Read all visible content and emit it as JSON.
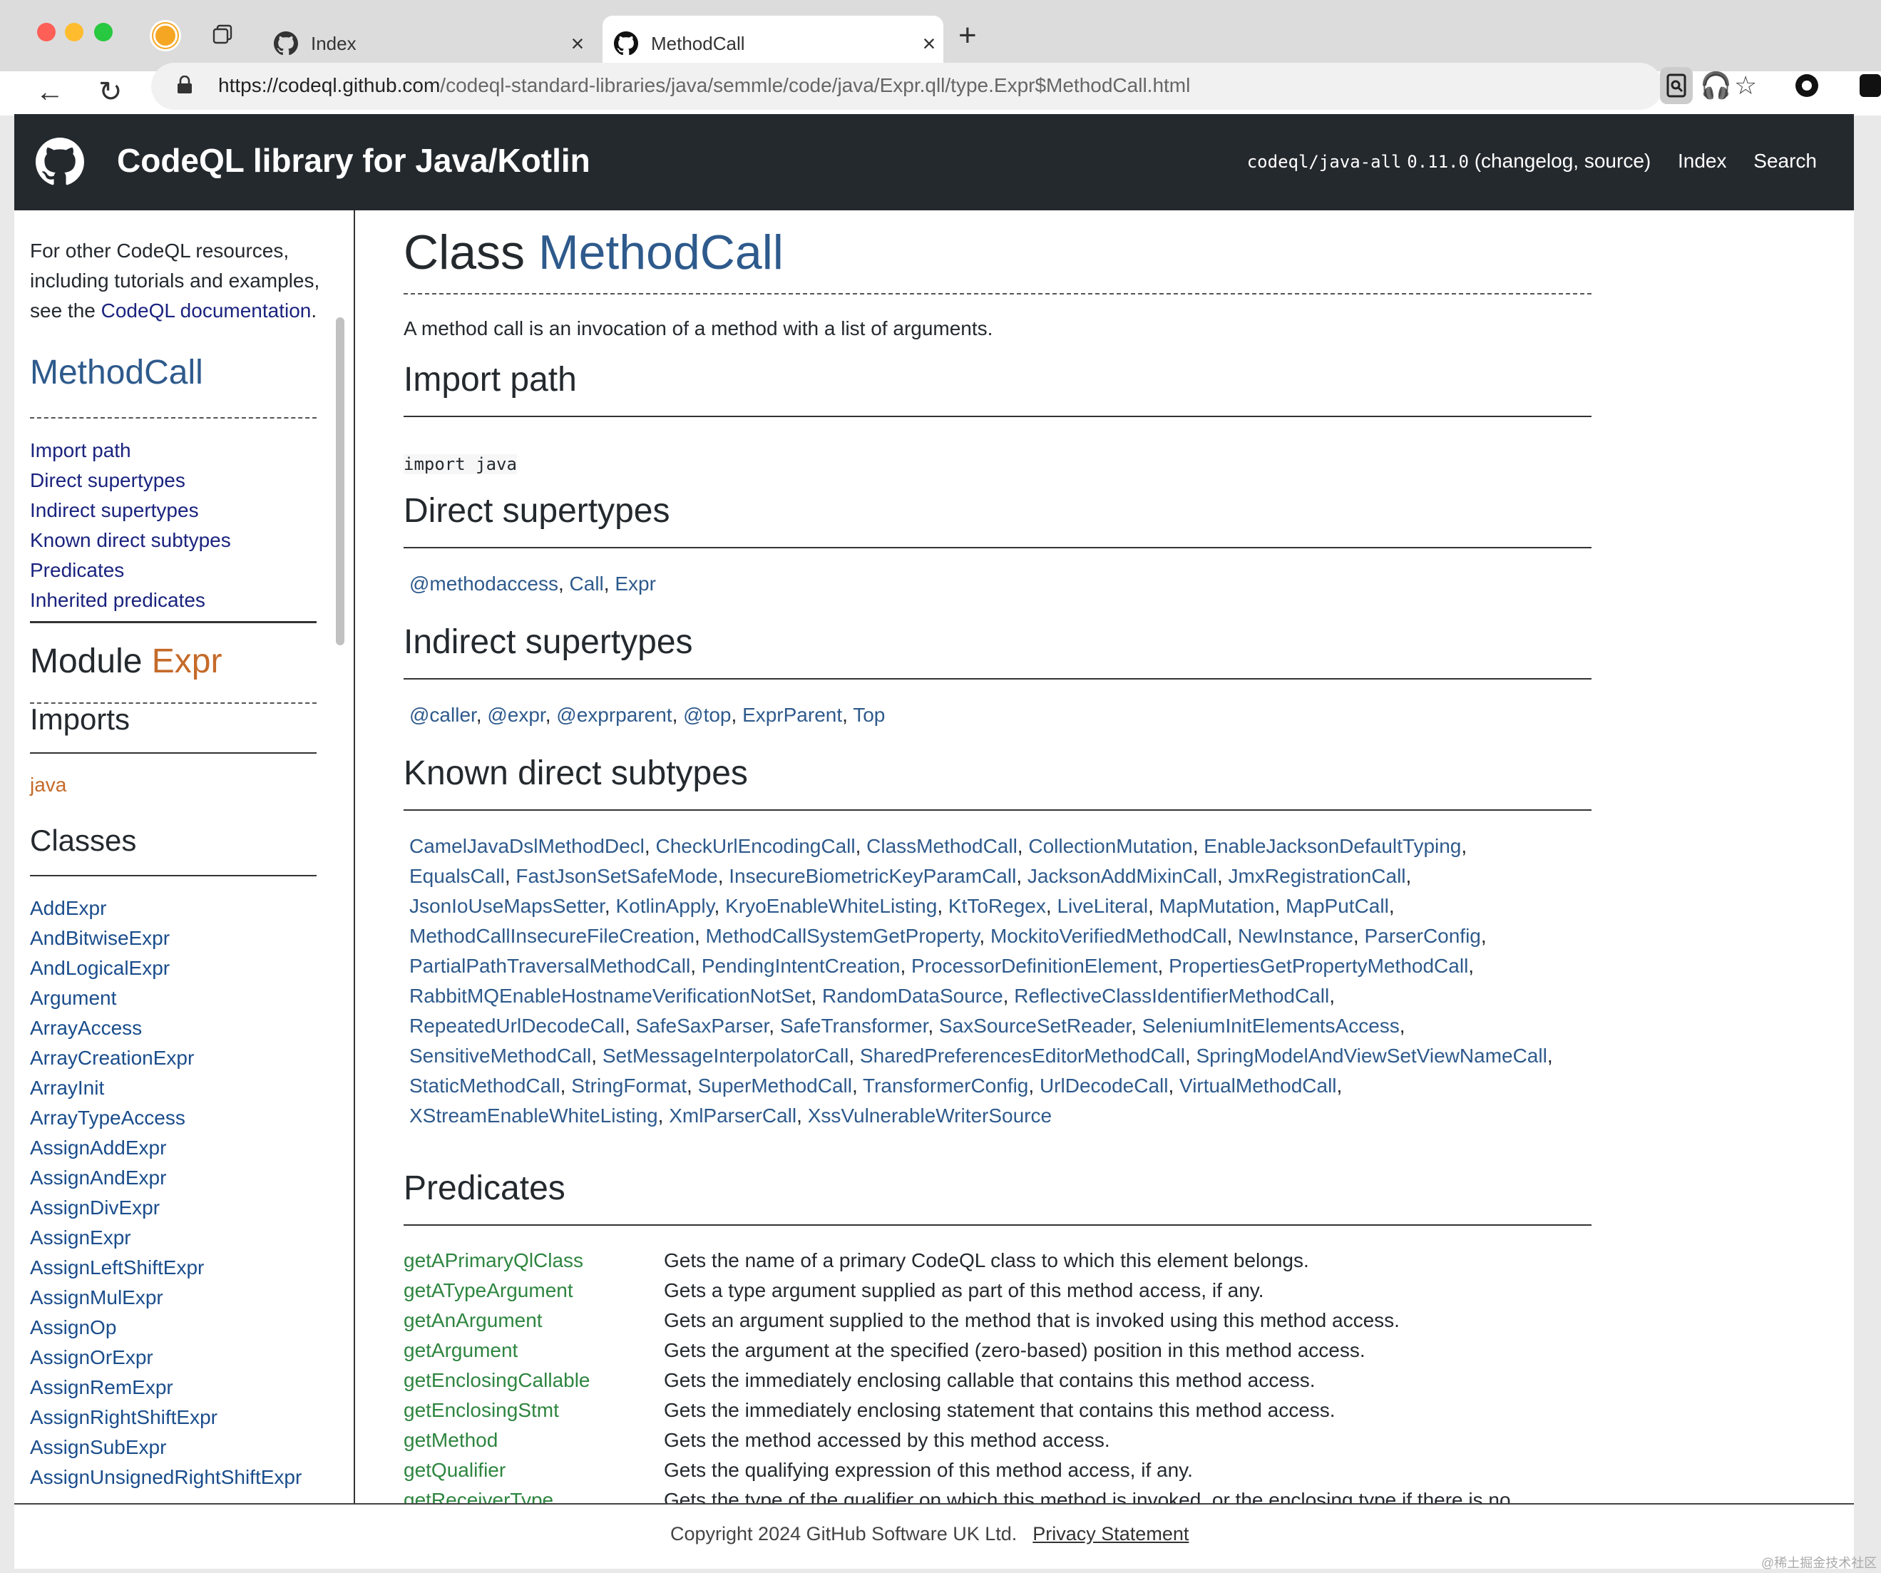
{
  "browser": {
    "tabs": [
      {
        "title": "Index"
      },
      {
        "title": "MethodCall"
      }
    ],
    "url_domain": "https://codeql.github.com",
    "url_path": "/codeql-standard-libraries/java/semmle/code/java/Expr.qll/type.Expr$MethodCall.html"
  },
  "header": {
    "title": "CodeQL library for Java/Kotlin",
    "package": "codeql/java-all",
    "version": "0.11.0",
    "version_links": "(changelog, source)",
    "index_link": "Index",
    "search_link": "Search"
  },
  "sidebar": {
    "intro_prefix": "For other CodeQL resources, including tutorials and examples, see the ",
    "intro_link": "CodeQL documentation",
    "intro_suffix": ".",
    "class_name": "MethodCall",
    "toc": [
      "Import path",
      "Direct supertypes",
      "Indirect supertypes",
      "Known direct subtypes",
      "Predicates",
      "Inherited predicates"
    ],
    "module_label": "Module",
    "module_name": "Expr",
    "imports_heading": "Imports",
    "imports": [
      "java"
    ],
    "classes_heading": "Classes",
    "classes": [
      "AddExpr",
      "AndBitwiseExpr",
      "AndLogicalExpr",
      "Argument",
      "ArrayAccess",
      "ArrayCreationExpr",
      "ArrayInit",
      "ArrayTypeAccess",
      "AssignAddExpr",
      "AssignAndExpr",
      "AssignDivExpr",
      "AssignExpr",
      "AssignLeftShiftExpr",
      "AssignMulExpr",
      "AssignOp",
      "AssignOrExpr",
      "AssignRemExpr",
      "AssignRightShiftExpr",
      "AssignSubExpr",
      "AssignUnsignedRightShiftExpr"
    ]
  },
  "main": {
    "class_label": "Class",
    "class_name": "MethodCall",
    "description": "A method call is an invocation of a method with a list of arguments.",
    "import_path_heading": "Import path",
    "import_code": "import java",
    "direct_supertypes_heading": "Direct supertypes",
    "direct_supertypes": [
      "@methodaccess",
      "Call",
      "Expr"
    ],
    "indirect_supertypes_heading": "Indirect supertypes",
    "indirect_supertypes": [
      "@caller",
      "@expr",
      "@exprparent",
      "@top",
      "ExprParent",
      "Top"
    ],
    "known_subtypes_heading": "Known direct subtypes",
    "known_subtypes_lines": [
      [
        "CamelJavaDslMethodDecl",
        "CheckUrlEncodingCall",
        "ClassMethodCall",
        "CollectionMutation",
        "EnableJacksonDefaultTyping"
      ],
      [
        "EqualsCall",
        "FastJsonSetSafeMode",
        "InsecureBiometricKeyParamCall",
        "JacksonAddMixinCall",
        "JmxRegistrationCall"
      ],
      [
        "JsonIoUseMapsSetter",
        "KotlinApply",
        "KryoEnableWhiteListing",
        "KtToRegex",
        "LiveLiteral",
        "MapMutation",
        "MapPutCall"
      ],
      [
        "MethodCallInsecureFileCreation",
        "MethodCallSystemGetProperty",
        "MockitoVerifiedMethodCall",
        "NewInstance",
        "ParserConfig"
      ],
      [
        "PartialPathTraversalMethodCall",
        "PendingIntentCreation",
        "ProcessorDefinitionElement",
        "PropertiesGetPropertyMethodCall"
      ],
      [
        "RabbitMQEnableHostnameVerificationNotSet",
        "RandomDataSource",
        "ReflectiveClassIdentifierMethodCall"
      ],
      [
        "RepeatedUrlDecodeCall",
        "SafeSaxParser",
        "SafeTransformer",
        "SaxSourceSetReader",
        "SeleniumInitElementsAccess"
      ],
      [
        "SensitiveMethodCall",
        "SetMessageInterpolatorCall",
        "SharedPreferencesEditorMethodCall",
        "SpringModelAndViewSetViewNameCall"
      ],
      [
        "StaticMethodCall",
        "StringFormat",
        "SuperMethodCall",
        "TransformerConfig",
        "UrlDecodeCall",
        "VirtualMethodCall"
      ],
      [
        "XStreamEnableWhiteListing",
        "XmlParserCall",
        "XssVulnerableWriterSource"
      ]
    ],
    "predicates_heading": "Predicates",
    "predicates": [
      {
        "name": "getAPrimaryQlClass",
        "desc": "Gets the name of a primary CodeQL class to which this element belongs."
      },
      {
        "name": "getATypeArgument",
        "desc": "Gets a type argument supplied as part of this method access, if any."
      },
      {
        "name": "getAnArgument",
        "desc": "Gets an argument supplied to the method that is invoked using this method access."
      },
      {
        "name": "getArgument",
        "desc": "Gets the argument at the specified (zero-based) position in this method access."
      },
      {
        "name": "getEnclosingCallable",
        "desc": "Gets the immediately enclosing callable that contains this method access."
      },
      {
        "name": "getEnclosingStmt",
        "desc": "Gets the immediately enclosing statement that contains this method access."
      },
      {
        "name": "getMethod",
        "desc": "Gets the method accessed by this method access."
      },
      {
        "name": "getQualifier",
        "desc": "Gets the qualifying expression of this method access, if any."
      },
      {
        "name": "getReceiverType",
        "desc": "Gets the type of the qualifier on which this method is invoked, or the enclosing type if there is no"
      }
    ]
  },
  "footer": {
    "copyright": "Copyright 2024 GitHub Software UK Ltd.",
    "privacy": "Privacy Statement"
  },
  "watermark": "@稀土掘金技术社区"
}
